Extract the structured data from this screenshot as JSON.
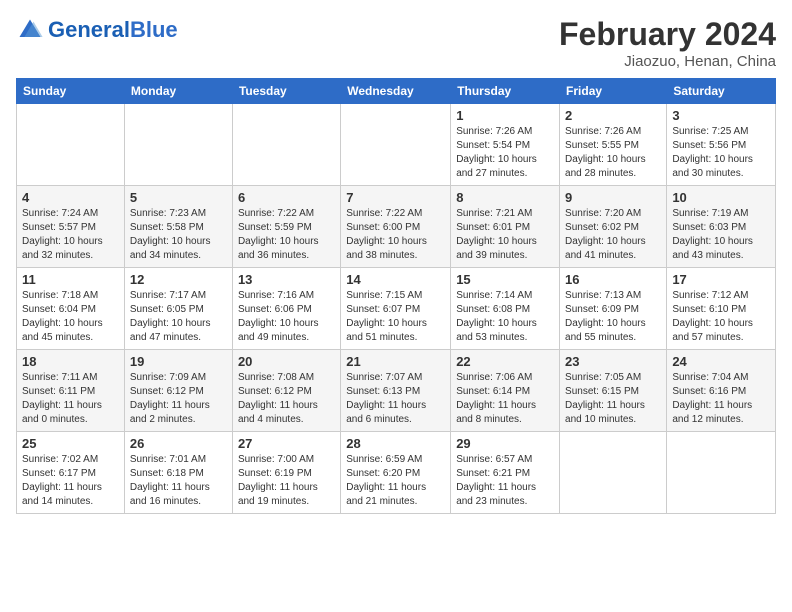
{
  "header": {
    "logo_general": "General",
    "logo_blue": "Blue",
    "title": "February 2024",
    "subtitle": "Jiaozuo, Henan, China"
  },
  "days_of_week": [
    "Sunday",
    "Monday",
    "Tuesday",
    "Wednesday",
    "Thursday",
    "Friday",
    "Saturday"
  ],
  "weeks": [
    [
      {
        "day": "",
        "info": ""
      },
      {
        "day": "",
        "info": ""
      },
      {
        "day": "",
        "info": ""
      },
      {
        "day": "",
        "info": ""
      },
      {
        "day": "1",
        "info": "Sunrise: 7:26 AM\nSunset: 5:54 PM\nDaylight: 10 hours and 27 minutes."
      },
      {
        "day": "2",
        "info": "Sunrise: 7:26 AM\nSunset: 5:55 PM\nDaylight: 10 hours and 28 minutes."
      },
      {
        "day": "3",
        "info": "Sunrise: 7:25 AM\nSunset: 5:56 PM\nDaylight: 10 hours and 30 minutes."
      }
    ],
    [
      {
        "day": "4",
        "info": "Sunrise: 7:24 AM\nSunset: 5:57 PM\nDaylight: 10 hours and 32 minutes."
      },
      {
        "day": "5",
        "info": "Sunrise: 7:23 AM\nSunset: 5:58 PM\nDaylight: 10 hours and 34 minutes."
      },
      {
        "day": "6",
        "info": "Sunrise: 7:22 AM\nSunset: 5:59 PM\nDaylight: 10 hours and 36 minutes."
      },
      {
        "day": "7",
        "info": "Sunrise: 7:22 AM\nSunset: 6:00 PM\nDaylight: 10 hours and 38 minutes."
      },
      {
        "day": "8",
        "info": "Sunrise: 7:21 AM\nSunset: 6:01 PM\nDaylight: 10 hours and 39 minutes."
      },
      {
        "day": "9",
        "info": "Sunrise: 7:20 AM\nSunset: 6:02 PM\nDaylight: 10 hours and 41 minutes."
      },
      {
        "day": "10",
        "info": "Sunrise: 7:19 AM\nSunset: 6:03 PM\nDaylight: 10 hours and 43 minutes."
      }
    ],
    [
      {
        "day": "11",
        "info": "Sunrise: 7:18 AM\nSunset: 6:04 PM\nDaylight: 10 hours and 45 minutes."
      },
      {
        "day": "12",
        "info": "Sunrise: 7:17 AM\nSunset: 6:05 PM\nDaylight: 10 hours and 47 minutes."
      },
      {
        "day": "13",
        "info": "Sunrise: 7:16 AM\nSunset: 6:06 PM\nDaylight: 10 hours and 49 minutes."
      },
      {
        "day": "14",
        "info": "Sunrise: 7:15 AM\nSunset: 6:07 PM\nDaylight: 10 hours and 51 minutes."
      },
      {
        "day": "15",
        "info": "Sunrise: 7:14 AM\nSunset: 6:08 PM\nDaylight: 10 hours and 53 minutes."
      },
      {
        "day": "16",
        "info": "Sunrise: 7:13 AM\nSunset: 6:09 PM\nDaylight: 10 hours and 55 minutes."
      },
      {
        "day": "17",
        "info": "Sunrise: 7:12 AM\nSunset: 6:10 PM\nDaylight: 10 hours and 57 minutes."
      }
    ],
    [
      {
        "day": "18",
        "info": "Sunrise: 7:11 AM\nSunset: 6:11 PM\nDaylight: 11 hours and 0 minutes."
      },
      {
        "day": "19",
        "info": "Sunrise: 7:09 AM\nSunset: 6:12 PM\nDaylight: 11 hours and 2 minutes."
      },
      {
        "day": "20",
        "info": "Sunrise: 7:08 AM\nSunset: 6:12 PM\nDaylight: 11 hours and 4 minutes."
      },
      {
        "day": "21",
        "info": "Sunrise: 7:07 AM\nSunset: 6:13 PM\nDaylight: 11 hours and 6 minutes."
      },
      {
        "day": "22",
        "info": "Sunrise: 7:06 AM\nSunset: 6:14 PM\nDaylight: 11 hours and 8 minutes."
      },
      {
        "day": "23",
        "info": "Sunrise: 7:05 AM\nSunset: 6:15 PM\nDaylight: 11 hours and 10 minutes."
      },
      {
        "day": "24",
        "info": "Sunrise: 7:04 AM\nSunset: 6:16 PM\nDaylight: 11 hours and 12 minutes."
      }
    ],
    [
      {
        "day": "25",
        "info": "Sunrise: 7:02 AM\nSunset: 6:17 PM\nDaylight: 11 hours and 14 minutes."
      },
      {
        "day": "26",
        "info": "Sunrise: 7:01 AM\nSunset: 6:18 PM\nDaylight: 11 hours and 16 minutes."
      },
      {
        "day": "27",
        "info": "Sunrise: 7:00 AM\nSunset: 6:19 PM\nDaylight: 11 hours and 19 minutes."
      },
      {
        "day": "28",
        "info": "Sunrise: 6:59 AM\nSunset: 6:20 PM\nDaylight: 11 hours and 21 minutes."
      },
      {
        "day": "29",
        "info": "Sunrise: 6:57 AM\nSunset: 6:21 PM\nDaylight: 11 hours and 23 minutes."
      },
      {
        "day": "",
        "info": ""
      },
      {
        "day": "",
        "info": ""
      }
    ]
  ]
}
